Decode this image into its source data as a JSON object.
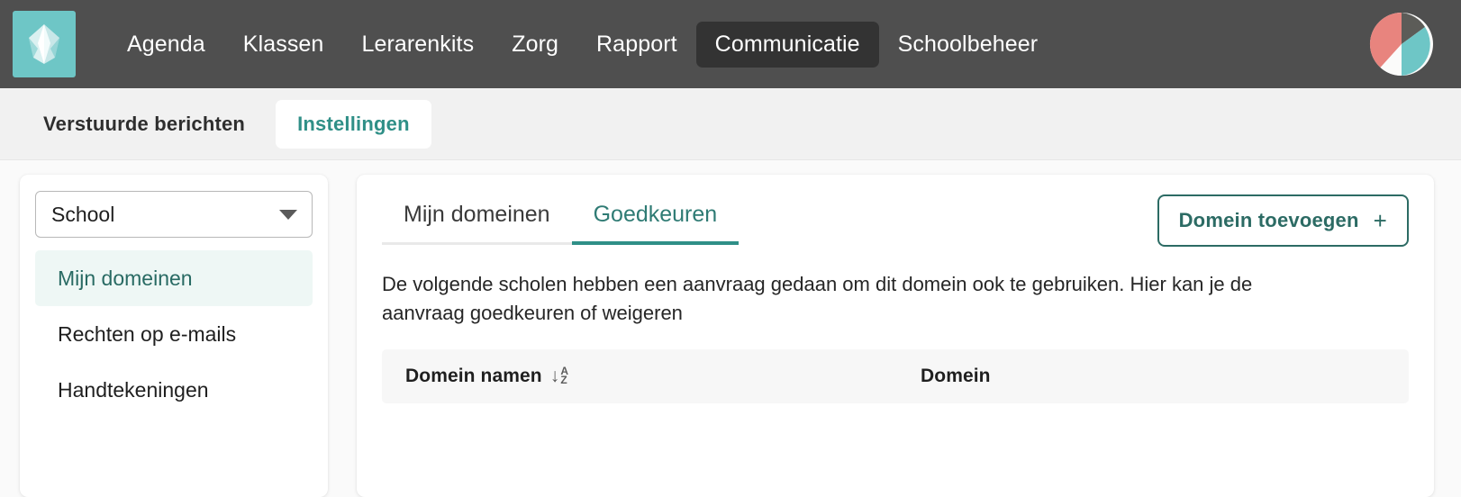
{
  "brand": {
    "logo_icon": "crystal-logo-icon",
    "logo_bg": "#6ec6c6",
    "nav_bg": "#4f4f4f",
    "accent": "#2f8f87",
    "accent_dark": "#2c6b64",
    "accent_soft_bg": "#eef7f5"
  },
  "topnav": {
    "items": [
      {
        "label": "Agenda",
        "active": false
      },
      {
        "label": "Klassen",
        "active": false
      },
      {
        "label": "Lerarenkits",
        "active": false
      },
      {
        "label": "Zorg",
        "active": false
      },
      {
        "label": "Rapport",
        "active": false
      },
      {
        "label": "Communicatie",
        "active": true
      },
      {
        "label": "Schoolbeheer",
        "active": false
      }
    ],
    "avatar": {
      "icon": "user-avatar-pie-icon",
      "colors": [
        "#e8847e",
        "#5c5c58",
        "#6ec6c6",
        "#fbfbfa"
      ]
    }
  },
  "subnav": {
    "title": "Verstuurde berichten",
    "pill_label": "Instellingen"
  },
  "sidebar": {
    "select": {
      "value": "School",
      "icon": "chevron-down-icon"
    },
    "items": [
      {
        "label": "Mijn domeinen",
        "active": true
      },
      {
        "label": "Rechten op e-mails",
        "active": false
      },
      {
        "label": "Handtekeningen",
        "active": false
      }
    ]
  },
  "main": {
    "tabs": [
      {
        "label": "Mijn domeinen",
        "active": false
      },
      {
        "label": "Goedkeuren",
        "active": true
      }
    ],
    "add_button": {
      "label": "Domein toevoegen",
      "icon": "plus-icon",
      "glyph": "+"
    },
    "description": "De volgende scholen hebben een aanvraag gedaan om dit domein ook te gebruiken. Hier kan je de aanvraag goedkeuren of weigeren",
    "table": {
      "columns": [
        {
          "label": "Domein namen",
          "sort_icon": "sort-a-z-descending-icon",
          "sort_arrow": "↓",
          "sort_top": "A",
          "sort_bottom": "Z"
        },
        {
          "label": "Domein",
          "sort_icon": null
        }
      ],
      "rows": []
    }
  }
}
